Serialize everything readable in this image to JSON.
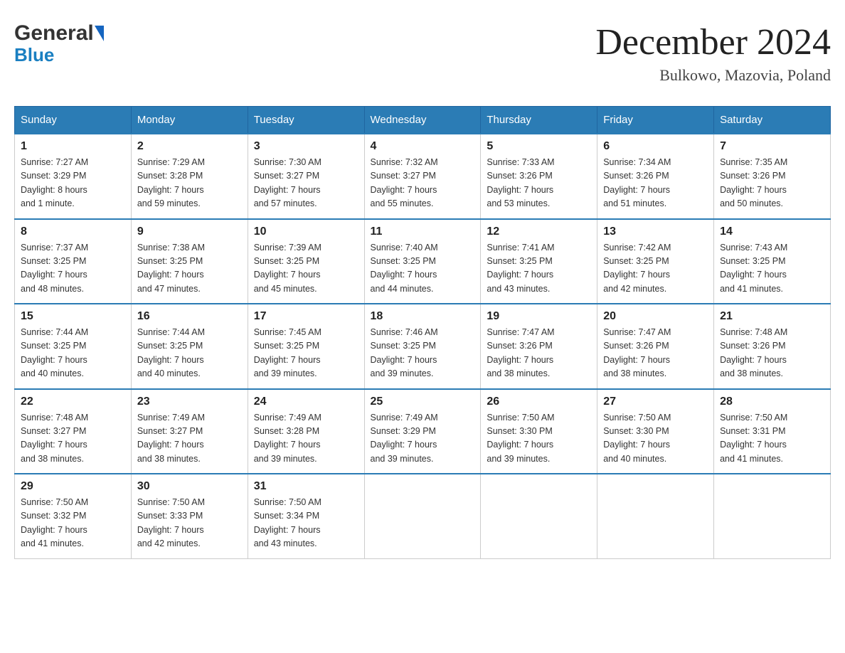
{
  "header": {
    "month_year": "December 2024",
    "location": "Bulkowo, Mazovia, Poland",
    "logo_general": "General",
    "logo_blue": "Blue"
  },
  "days_of_week": [
    "Sunday",
    "Monday",
    "Tuesday",
    "Wednesday",
    "Thursday",
    "Friday",
    "Saturday"
  ],
  "weeks": [
    [
      {
        "day": "1",
        "sunrise": "7:27 AM",
        "sunset": "3:29 PM",
        "daylight": "8 hours and 1 minute."
      },
      {
        "day": "2",
        "sunrise": "7:29 AM",
        "sunset": "3:28 PM",
        "daylight": "7 hours and 59 minutes."
      },
      {
        "day": "3",
        "sunrise": "7:30 AM",
        "sunset": "3:27 PM",
        "daylight": "7 hours and 57 minutes."
      },
      {
        "day": "4",
        "sunrise": "7:32 AM",
        "sunset": "3:27 PM",
        "daylight": "7 hours and 55 minutes."
      },
      {
        "day": "5",
        "sunrise": "7:33 AM",
        "sunset": "3:26 PM",
        "daylight": "7 hours and 53 minutes."
      },
      {
        "day": "6",
        "sunrise": "7:34 AM",
        "sunset": "3:26 PM",
        "daylight": "7 hours and 51 minutes."
      },
      {
        "day": "7",
        "sunrise": "7:35 AM",
        "sunset": "3:26 PM",
        "daylight": "7 hours and 50 minutes."
      }
    ],
    [
      {
        "day": "8",
        "sunrise": "7:37 AM",
        "sunset": "3:25 PM",
        "daylight": "7 hours and 48 minutes."
      },
      {
        "day": "9",
        "sunrise": "7:38 AM",
        "sunset": "3:25 PM",
        "daylight": "7 hours and 47 minutes."
      },
      {
        "day": "10",
        "sunrise": "7:39 AM",
        "sunset": "3:25 PM",
        "daylight": "7 hours and 45 minutes."
      },
      {
        "day": "11",
        "sunrise": "7:40 AM",
        "sunset": "3:25 PM",
        "daylight": "7 hours and 44 minutes."
      },
      {
        "day": "12",
        "sunrise": "7:41 AM",
        "sunset": "3:25 PM",
        "daylight": "7 hours and 43 minutes."
      },
      {
        "day": "13",
        "sunrise": "7:42 AM",
        "sunset": "3:25 PM",
        "daylight": "7 hours and 42 minutes."
      },
      {
        "day": "14",
        "sunrise": "7:43 AM",
        "sunset": "3:25 PM",
        "daylight": "7 hours and 41 minutes."
      }
    ],
    [
      {
        "day": "15",
        "sunrise": "7:44 AM",
        "sunset": "3:25 PM",
        "daylight": "7 hours and 40 minutes."
      },
      {
        "day": "16",
        "sunrise": "7:44 AM",
        "sunset": "3:25 PM",
        "daylight": "7 hours and 40 minutes."
      },
      {
        "day": "17",
        "sunrise": "7:45 AM",
        "sunset": "3:25 PM",
        "daylight": "7 hours and 39 minutes."
      },
      {
        "day": "18",
        "sunrise": "7:46 AM",
        "sunset": "3:25 PM",
        "daylight": "7 hours and 39 minutes."
      },
      {
        "day": "19",
        "sunrise": "7:47 AM",
        "sunset": "3:26 PM",
        "daylight": "7 hours and 38 minutes."
      },
      {
        "day": "20",
        "sunrise": "7:47 AM",
        "sunset": "3:26 PM",
        "daylight": "7 hours and 38 minutes."
      },
      {
        "day": "21",
        "sunrise": "7:48 AM",
        "sunset": "3:26 PM",
        "daylight": "7 hours and 38 minutes."
      }
    ],
    [
      {
        "day": "22",
        "sunrise": "7:48 AM",
        "sunset": "3:27 PM",
        "daylight": "7 hours and 38 minutes."
      },
      {
        "day": "23",
        "sunrise": "7:49 AM",
        "sunset": "3:27 PM",
        "daylight": "7 hours and 38 minutes."
      },
      {
        "day": "24",
        "sunrise": "7:49 AM",
        "sunset": "3:28 PM",
        "daylight": "7 hours and 39 minutes."
      },
      {
        "day": "25",
        "sunrise": "7:49 AM",
        "sunset": "3:29 PM",
        "daylight": "7 hours and 39 minutes."
      },
      {
        "day": "26",
        "sunrise": "7:50 AM",
        "sunset": "3:30 PM",
        "daylight": "7 hours and 39 minutes."
      },
      {
        "day": "27",
        "sunrise": "7:50 AM",
        "sunset": "3:30 PM",
        "daylight": "7 hours and 40 minutes."
      },
      {
        "day": "28",
        "sunrise": "7:50 AM",
        "sunset": "3:31 PM",
        "daylight": "7 hours and 41 minutes."
      }
    ],
    [
      {
        "day": "29",
        "sunrise": "7:50 AM",
        "sunset": "3:32 PM",
        "daylight": "7 hours and 41 minutes."
      },
      {
        "day": "30",
        "sunrise": "7:50 AM",
        "sunset": "3:33 PM",
        "daylight": "7 hours and 42 minutes."
      },
      {
        "day": "31",
        "sunrise": "7:50 AM",
        "sunset": "3:34 PM",
        "daylight": "7 hours and 43 minutes."
      },
      null,
      null,
      null,
      null
    ]
  ],
  "labels": {
    "sunrise": "Sunrise:",
    "sunset": "Sunset:",
    "daylight": "Daylight:"
  }
}
